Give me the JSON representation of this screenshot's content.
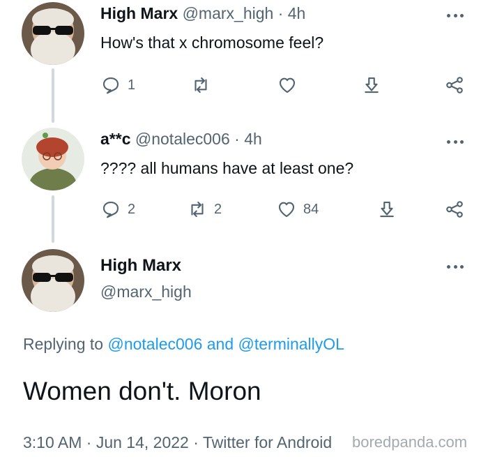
{
  "tweets": [
    {
      "display_name": "High Marx",
      "handle": "@marx_high",
      "time": "· 4h",
      "text": "How's that x chromosome feel?",
      "actions": {
        "reply": "1",
        "retweet": "",
        "like": ""
      }
    },
    {
      "display_name": "a**c",
      "handle": "@notalec006",
      "time": "· 4h",
      "text": "???? all humans have at least one?",
      "actions": {
        "reply": "2",
        "retweet": "2",
        "like": "84"
      }
    }
  ],
  "main_tweet": {
    "display_name": "High Marx",
    "handle": "@marx_high",
    "replying_prefix": "Replying to",
    "mention_1": "@notalec006",
    "and": "and",
    "mention_2": "@terminallyOL",
    "text": "Women don't. Moron",
    "timestamp": "3:10 AM · Jun 14, 2022 · Twitter for Android"
  },
  "watermark": "boredpanda.com",
  "icons": [
    "reply-icon",
    "retweet-icon",
    "like-icon",
    "share-icon",
    "more-icon"
  ],
  "colors": {
    "accent": "#1d9bf0",
    "secondary_text": "#536471",
    "thread_line": "#cfd9de"
  }
}
